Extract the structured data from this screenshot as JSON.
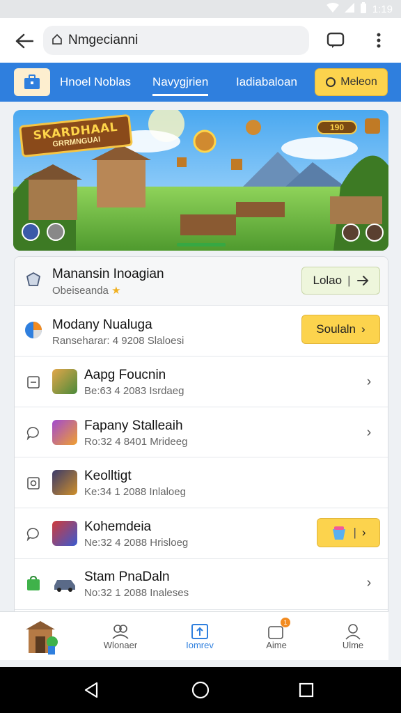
{
  "status": {
    "time": "1:19"
  },
  "browser": {
    "url": "Nmgecianni"
  },
  "nav": {
    "tabs": [
      {
        "label": "Hnoel Noblas"
      },
      {
        "label": "Navygjrien"
      },
      {
        "label": "Iadiabaloan"
      }
    ],
    "cta_label": "Meleon"
  },
  "banner": {
    "logo_title": "SKARDHAAL",
    "logo_sub": "GRRMNGUAI",
    "coins": "190"
  },
  "list": [
    {
      "title": "Manansin Inoagian",
      "sub": "Obeiseanda",
      "action": "Lolao"
    },
    {
      "title": "Modany Nualuga",
      "sub": "Ranseharar: 4 9208 Slaloesi",
      "action": "Soulaln"
    },
    {
      "title": "Aapg Foucnin",
      "sub": "Be:63 4 2083 Isrdaeg"
    },
    {
      "title": "Fapany Stalleaih",
      "sub": "Ro:32 4 8401 Mrideeg"
    },
    {
      "title": "Keolltigt",
      "sub": "Ke:34 1 2088 Inlaloeg"
    },
    {
      "title": "Kohemdeia",
      "sub": "Ne:32 4 2088 Hrisloeg"
    },
    {
      "title": "Stam PnaDaln",
      "sub": "No:32 1 2088 Inaleses"
    }
  ],
  "bottom_nav": [
    {
      "label": "Wlonaer"
    },
    {
      "label": "Iomrev"
    },
    {
      "label": "Aime",
      "badge": "1"
    },
    {
      "label": "Ulme"
    }
  ],
  "colors": {
    "primary": "#2f7fde",
    "accent": "#fcd34d"
  }
}
